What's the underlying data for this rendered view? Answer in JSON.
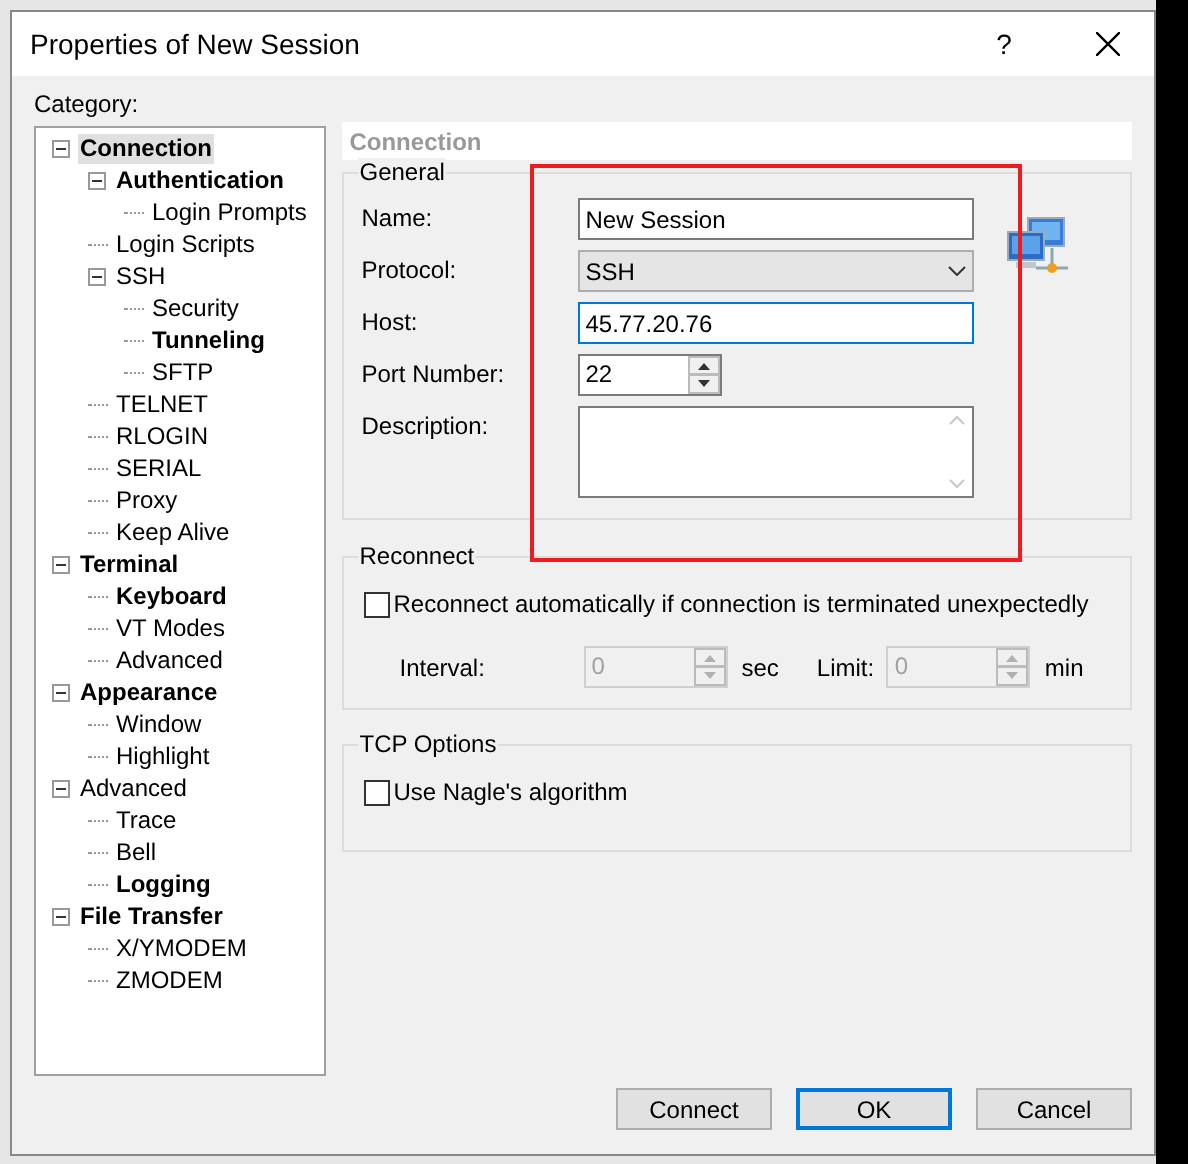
{
  "window": {
    "title": "Properties of New Session",
    "help": "?"
  },
  "category_label": "Category:",
  "tree": [
    {
      "label": "Connection",
      "bold": true,
      "selected": true,
      "expanded": true,
      "children": [
        {
          "label": "Authentication",
          "bold": true,
          "selected": false,
          "expanded": true,
          "children": [
            {
              "label": "Login Prompts",
              "bold": false,
              "selected": false
            }
          ]
        },
        {
          "label": "Login Scripts",
          "bold": false,
          "selected": false
        },
        {
          "label": "SSH",
          "bold": false,
          "selected": false,
          "expanded": true,
          "children": [
            {
              "label": "Security",
              "bold": false,
              "selected": false
            },
            {
              "label": "Tunneling",
              "bold": true,
              "selected": false
            },
            {
              "label": "SFTP",
              "bold": false,
              "selected": false
            }
          ]
        },
        {
          "label": "TELNET",
          "bold": false,
          "selected": false
        },
        {
          "label": "RLOGIN",
          "bold": false,
          "selected": false
        },
        {
          "label": "SERIAL",
          "bold": false,
          "selected": false
        },
        {
          "label": "Proxy",
          "bold": false,
          "selected": false
        },
        {
          "label": "Keep Alive",
          "bold": false,
          "selected": false
        }
      ]
    },
    {
      "label": "Terminal",
      "bold": true,
      "selected": false,
      "expanded": true,
      "children": [
        {
          "label": "Keyboard",
          "bold": true,
          "selected": false
        },
        {
          "label": "VT Modes",
          "bold": false,
          "selected": false
        },
        {
          "label": "Advanced",
          "bold": false,
          "selected": false
        }
      ]
    },
    {
      "label": "Appearance",
      "bold": true,
      "selected": false,
      "expanded": true,
      "children": [
        {
          "label": "Window",
          "bold": false,
          "selected": false
        },
        {
          "label": "Highlight",
          "bold": false,
          "selected": false
        }
      ]
    },
    {
      "label": "Advanced",
      "bold": false,
      "selected": false,
      "expanded": true,
      "children": [
        {
          "label": "Trace",
          "bold": false,
          "selected": false
        },
        {
          "label": "Bell",
          "bold": false,
          "selected": false
        },
        {
          "label": "Logging",
          "bold": true,
          "selected": false
        }
      ]
    },
    {
      "label": "File Transfer",
      "bold": true,
      "selected": false,
      "expanded": true,
      "children": [
        {
          "label": "X/YMODEM",
          "bold": false,
          "selected": false
        },
        {
          "label": "ZMODEM",
          "bold": false,
          "selected": false
        }
      ]
    }
  ],
  "section_title": "Connection",
  "general": {
    "title": "General",
    "fields": [
      {
        "kind": "text",
        "label": "Name:",
        "value": "New Session",
        "focused": false
      },
      {
        "kind": "select",
        "label": "Protocol:",
        "value": "SSH",
        "focused": false
      },
      {
        "kind": "text",
        "label": "Host:",
        "value": "45.77.20.76",
        "focused": true
      },
      {
        "kind": "spin",
        "label": "Port Number:",
        "value": "22",
        "focused": false
      },
      {
        "kind": "textarea",
        "label": "Description:",
        "focused": false
      }
    ]
  },
  "reconnect": {
    "title": "Reconnect",
    "checkbox": {
      "label": "Reconnect automatically if connection is terminated unexpectedly",
      "checked": false
    },
    "interval": {
      "label": "Interval:",
      "value": "0",
      "unit": "sec",
      "disabled": true
    },
    "limit": {
      "label": "Limit:",
      "value": "0",
      "unit": "min",
      "disabled": true
    }
  },
  "tcp_options": {
    "title": "TCP Options",
    "checkbox": {
      "label": "Use Nagle's algorithm",
      "checked": false
    }
  },
  "buttons": [
    {
      "label": "Connect",
      "default": false
    },
    {
      "label": "OK",
      "default": true
    },
    {
      "label": "Cancel",
      "default": false
    }
  ]
}
